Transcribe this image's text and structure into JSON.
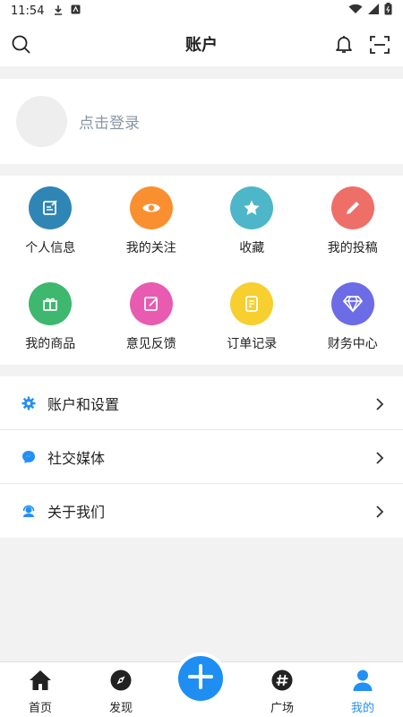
{
  "status_bar": {
    "time": "11:54"
  },
  "header": {
    "title": "账户"
  },
  "profile": {
    "login_text": "点击登录"
  },
  "grid": [
    {
      "label": "个人信息",
      "color": "#2f86b5",
      "icon": "edit-note-icon"
    },
    {
      "label": "我的关注",
      "color": "#fa8f2f",
      "icon": "eye-icon"
    },
    {
      "label": "收藏",
      "color": "#4eb6c9",
      "icon": "star-icon"
    },
    {
      "label": "我的投稿",
      "color": "#ee6f68",
      "icon": "pencil-icon"
    },
    {
      "label": "我的商品",
      "color": "#3db86e",
      "icon": "gift-icon"
    },
    {
      "label": "意见反馈",
      "color": "#e85bb0",
      "icon": "feedback-icon"
    },
    {
      "label": "订单记录",
      "color": "#f7cf2e",
      "icon": "order-icon"
    },
    {
      "label": "财务中心",
      "color": "#6c6ce6",
      "icon": "diamond-icon"
    }
  ],
  "menu": [
    {
      "label": "账户和设置",
      "icon": "gear-icon"
    },
    {
      "label": "社交媒体",
      "icon": "messenger-icon"
    },
    {
      "label": "关于我们",
      "icon": "support-agent-icon"
    }
  ],
  "tabs": [
    {
      "label": "首页",
      "icon": "home-icon"
    },
    {
      "label": "发现",
      "icon": "compass-icon"
    },
    {
      "label": "广场",
      "icon": "hashtag-icon"
    },
    {
      "label": "我的",
      "icon": "person-icon",
      "active": true
    }
  ],
  "colors": {
    "accent": "#1f8ef2",
    "active_tab": "#2290f5",
    "login_text": "#8a96a6"
  }
}
